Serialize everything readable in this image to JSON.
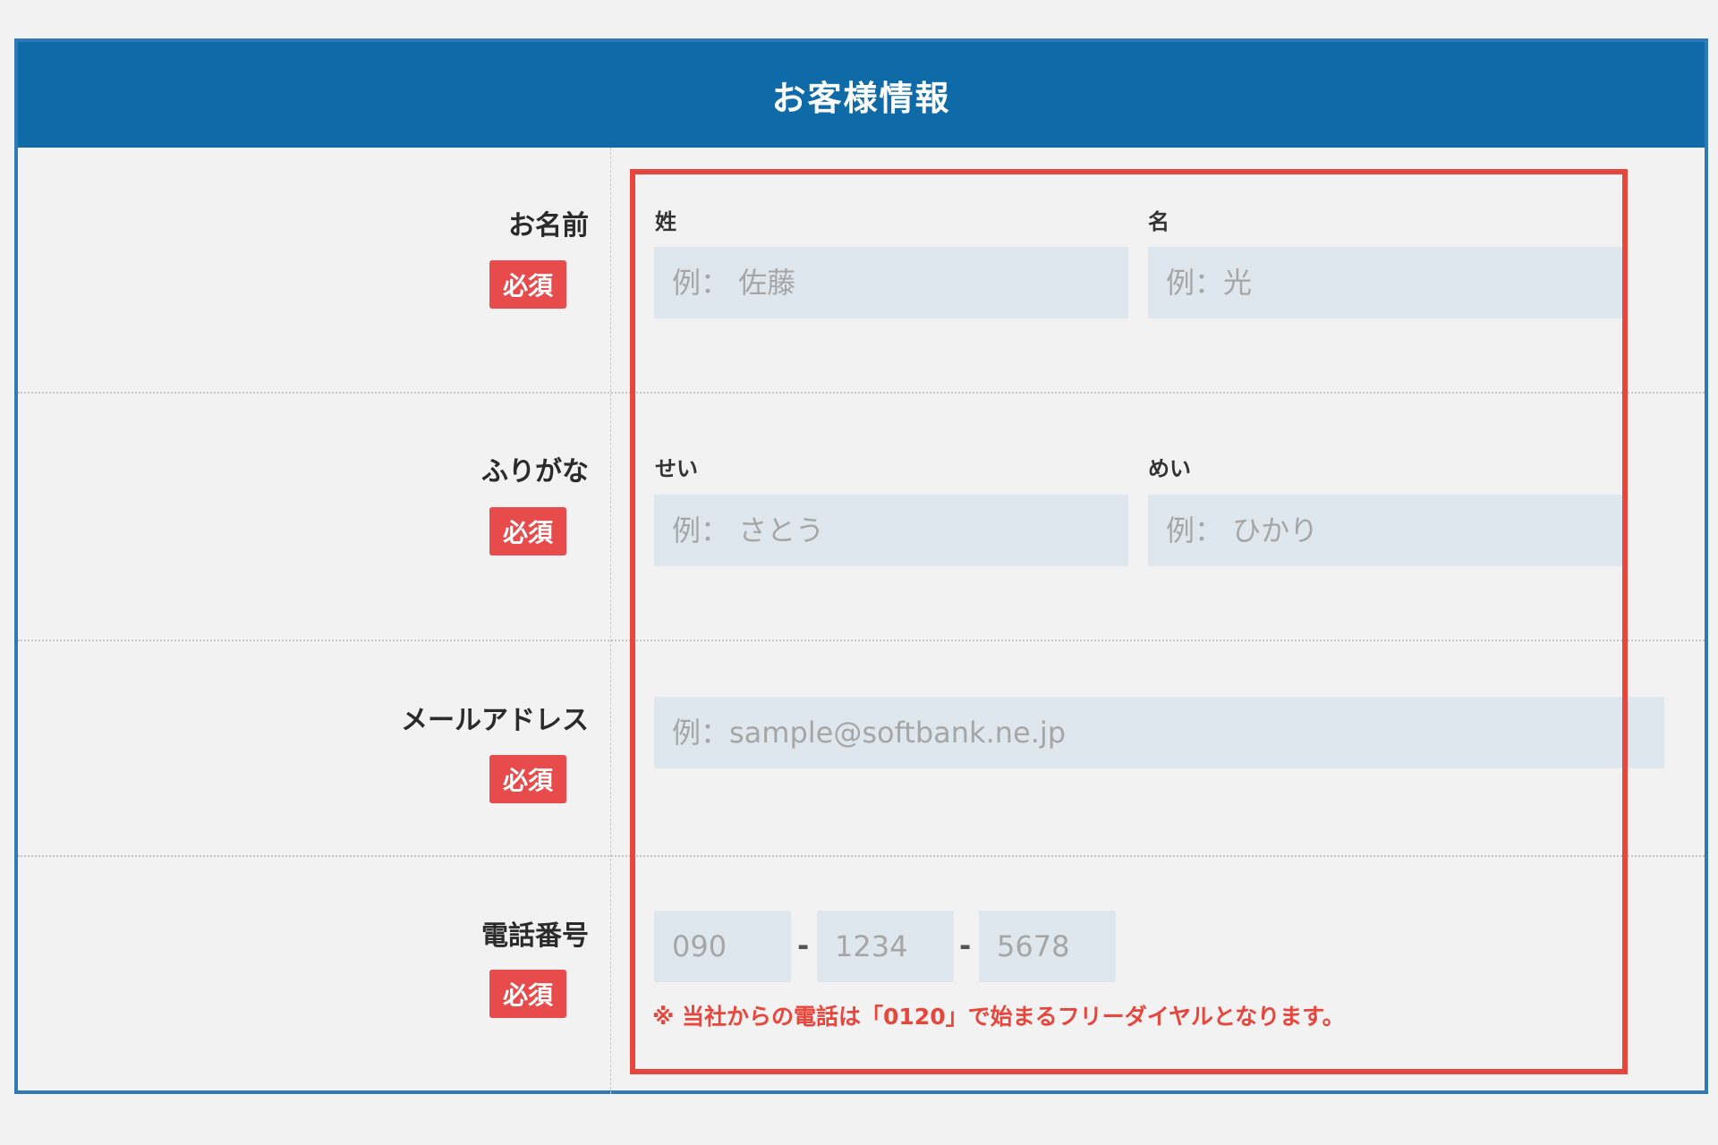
{
  "header": {
    "title": "お客様情報"
  },
  "rows": {
    "name": {
      "label": "お名前",
      "badge": "必須",
      "last_label": "姓",
      "last_placeholder": "例： 佐藤",
      "first_label": "名",
      "first_placeholder": "例：光"
    },
    "furigana": {
      "label": "ふりがな",
      "badge": "必須",
      "last_label": "せい",
      "last_placeholder": "例： さとう",
      "first_label": "めい",
      "first_placeholder": "例： ひかり"
    },
    "email": {
      "label": "メールアドレス",
      "badge": "必須",
      "placeholder": "例：sample@softbank.ne.jp"
    },
    "phone": {
      "label": "電話番号",
      "badge": "必須",
      "part1_placeholder": "090",
      "part2_placeholder": "1234",
      "part3_placeholder": "5678",
      "separator": "-",
      "note": "※ 当社からの電話は「0120」で始まるフリーダイヤルとなります。"
    }
  },
  "colors": {
    "header_bg": "#0f6aa8",
    "badge_bg": "#e84b4b",
    "highlight": "#e8463c",
    "field_bg": "#dfe7ee"
  }
}
